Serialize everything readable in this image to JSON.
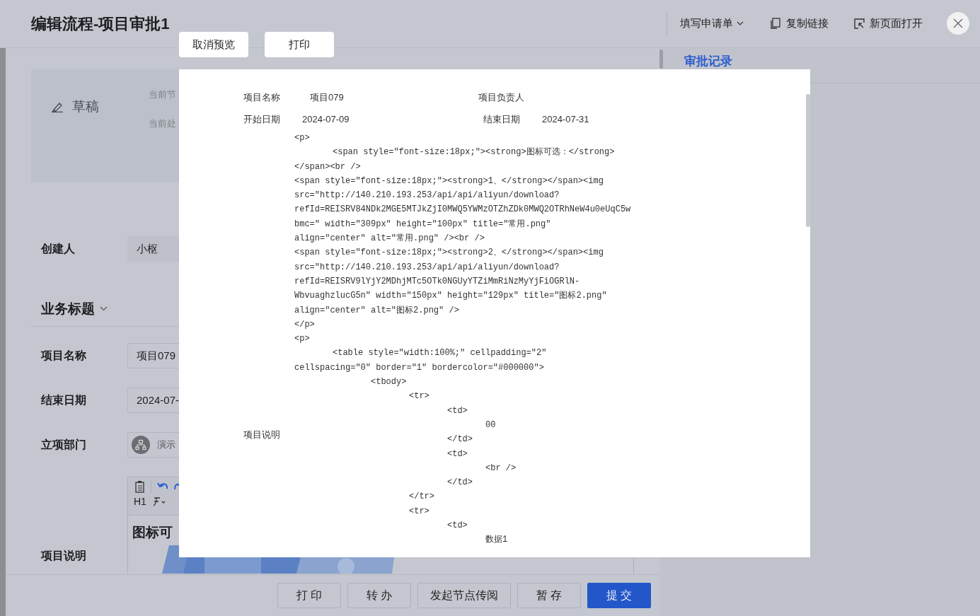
{
  "header": {
    "title": "编辑流程-项目审批1",
    "actions": [
      {
        "kind": "dropdown",
        "label": "填写申请单"
      },
      {
        "kind": "copy",
        "label": "复制链接"
      },
      {
        "kind": "open",
        "label": "新页面打开"
      }
    ]
  },
  "status": {
    "label": "草稿",
    "lines": [
      "当前节",
      "当前处"
    ]
  },
  "form": {
    "creator": {
      "label": "创建人",
      "value": "小枢"
    },
    "section": {
      "title": "业务标题",
      "expanded": true
    },
    "fields": [
      {
        "kind": "text",
        "label": "项目名称",
        "value": "项目079"
      },
      {
        "kind": "text",
        "label": "结束日期",
        "value": "2024-07-"
      },
      {
        "kind": "dept",
        "label": "立项部门",
        "value": "演示"
      }
    ],
    "editor": {
      "label": "项目说明",
      "heading_tool": "H1",
      "content_heading": "图标可"
    }
  },
  "right_panel": {
    "tabs": [
      {
        "label": "审批记录",
        "selected": true
      }
    ]
  },
  "footer_buttons": [
    {
      "label": "打 印",
      "primary": false
    },
    {
      "label": "转 办",
      "primary": false
    },
    {
      "label": "发起节点传阅",
      "primary": false
    },
    {
      "label": "暂 存",
      "primary": false
    },
    {
      "label": "提 交",
      "primary": true
    }
  ],
  "preview": {
    "buttons": [
      "取消预览",
      "打印"
    ],
    "fields": [
      {
        "label": "项目名称",
        "value": "项目079"
      },
      {
        "label": "项目负责人"
      },
      {
        "label": "开始日期",
        "value": "2024-07-09"
      },
      {
        "label": "结束日期",
        "value": "2024-07-31"
      }
    ],
    "description_label": "项目说明",
    "code_lines": [
      "<p>",
      "\t<span style=\"font-size:18px;\"><strong>图标可选：</strong>",
      "</span><br />",
      "<span style=\"font-size:18px;\"><strong>1、</strong></span><img",
      "src=\"http://140.210.193.253/api/api/aliyun/download?",
      "refId=REISRV84NDk2MGE5MTJkZjI0MWQ5YWMzOTZhZDk0MWQ2OTRhNeW4u0eUqC5w",
      "bmc=\" width=\"309px\" height=\"100px\" title=\"常用.png\"",
      "align=\"center\" alt=\"常用.png\" /><br />",
      "<span style=\"font-size:18px;\"><strong>2、</strong></span><img",
      "src=\"http://140.210.193.253/api/api/aliyun/download?",
      "refId=REISRV9lYjY2MDhjMTc5OTk0NGUyYTZiMmRiNzMyYjFiOGRlN-",
      "WbvuaghzlucG5n\" width=\"150px\" height=\"129px\" title=\"图标2.png\"",
      "align=\"center\" alt=\"图标2.png\" />",
      "</p>",
      "<p>",
      "\t<table style=\"width:100%;\" cellpadding=\"2\"",
      "cellspacing=\"0\" border=\"1\" bordercolor=\"#000000\">",
      "\t\t<tbody>",
      "\t\t\t<tr>",
      "\t\t\t\t<td>",
      "\t\t\t\t\t00",
      "\t\t\t\t</td>",
      "\t\t\t\t<td>",
      "\t\t\t\t\t<br />",
      "\t\t\t\t</td>",
      "\t\t\t</tr>",
      "\t\t\t<tr>",
      "\t\t\t\t<td>",
      "\t\t\t\t\t数据1"
    ]
  }
}
